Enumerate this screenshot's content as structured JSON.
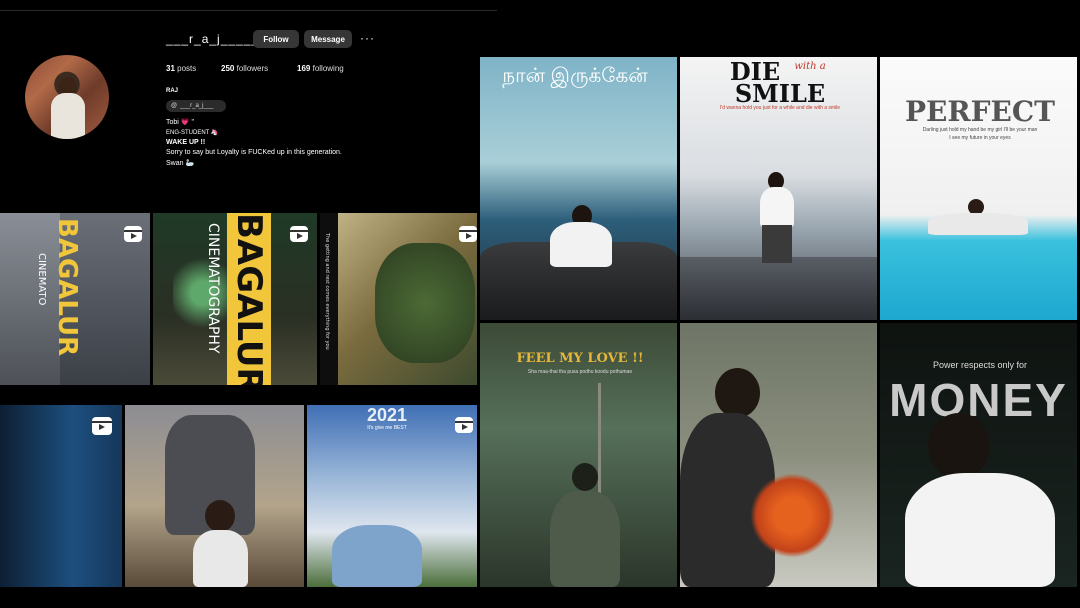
{
  "profile": {
    "username": "___r_a_j_____",
    "follow_label": "Follow",
    "message_label": "Message",
    "more_label": "···",
    "posts": "31",
    "posts_label": "posts",
    "followers": "250",
    "followers_label": "followers",
    "following": "169",
    "following_label": "following",
    "name": "RAJ",
    "threads_handle": "___r_a_j___",
    "bio_line1": "Tobi 💗 \"",
    "bio_line2": "ENG-STUDENT 🦄",
    "bio_line3": "WAKE UP !!",
    "bio_line4": "Sorry to say but Loyalty is FUCKed up in this generation.",
    "bio_line5": "Swan 🦢"
  },
  "grid_left": {
    "tile1_text": "BAGALUR",
    "tile1_sub": "CINEMATO",
    "tile2_text": "BAGALUR",
    "tile2_sub": "CINEMATOGRAPHY",
    "tile3_text": "The getting and rest comes everything for you",
    "tile5_text": "2021",
    "tile5_sub": "It's give me BEST"
  },
  "grid_right": {
    "tile1_text": "நான் இருக்கேன்",
    "tile2_title": "DIE",
    "tile2_script": "with a",
    "tile2_title2": "SMILE",
    "tile2_caption": "I'd wanna hold you just for a while and die with a smile",
    "tile3_title": "PERFECT",
    "tile3_caption1": "Darling just hold my hand be my girl I'll be your man",
    "tile3_caption2": "I see my future in your eyes",
    "tile4_title": "FEEL MY LOVE !!",
    "tile4_caption": "Sha maa-thai tha pusa podhu koodu pothumae",
    "tile6_caption": "Power respects only for",
    "tile6_title": "MONEY"
  }
}
